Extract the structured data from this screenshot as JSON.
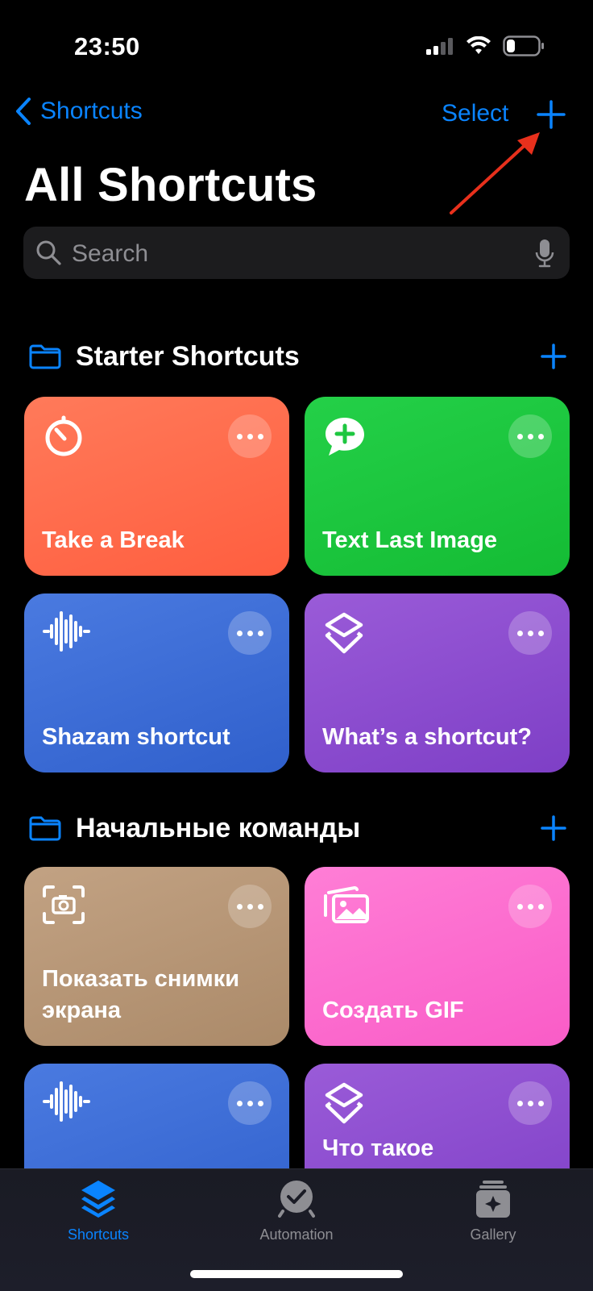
{
  "status_bar": {
    "time": "23:50"
  },
  "nav": {
    "back_label": "Shortcuts",
    "select_label": "Select"
  },
  "page": {
    "title": "All Shortcuts"
  },
  "search": {
    "placeholder": "Search"
  },
  "sections": [
    {
      "title": "Starter Shortcuts",
      "tiles": [
        {
          "name": "Take a Break",
          "icon": "timer-icon",
          "color": "#ff6a4d"
        },
        {
          "name": "Text Last Image",
          "icon": "message-plus-icon",
          "color": "#1ec740"
        },
        {
          "name": "Shazam shortcut",
          "icon": "waveform-icon",
          "color": "#3f6ed6"
        },
        {
          "name": "What’s a shortcut?",
          "icon": "layers-icon",
          "color": "#8e4fd0"
        }
      ]
    },
    {
      "title": "Начальные команды",
      "tiles": [
        {
          "name": "Показать снимки экрана",
          "icon": "screenshot-icon",
          "color": "#b89777"
        },
        {
          "name": "Создать GIF",
          "icon": "photos-icon",
          "color": "#ff6fd0"
        },
        {
          "name": "",
          "icon": "waveform-icon",
          "color": "#3f6ed6"
        },
        {
          "name": "Что такое",
          "icon": "layers-icon",
          "color": "#8e4fd0"
        }
      ]
    }
  ],
  "tabbar": {
    "tabs": [
      {
        "label": "Shortcuts",
        "active": true
      },
      {
        "label": "Automation",
        "active": false
      },
      {
        "label": "Gallery",
        "active": false
      }
    ]
  },
  "colors": {
    "accent": "#0a84ff",
    "annotation_arrow": "#e8301c"
  }
}
